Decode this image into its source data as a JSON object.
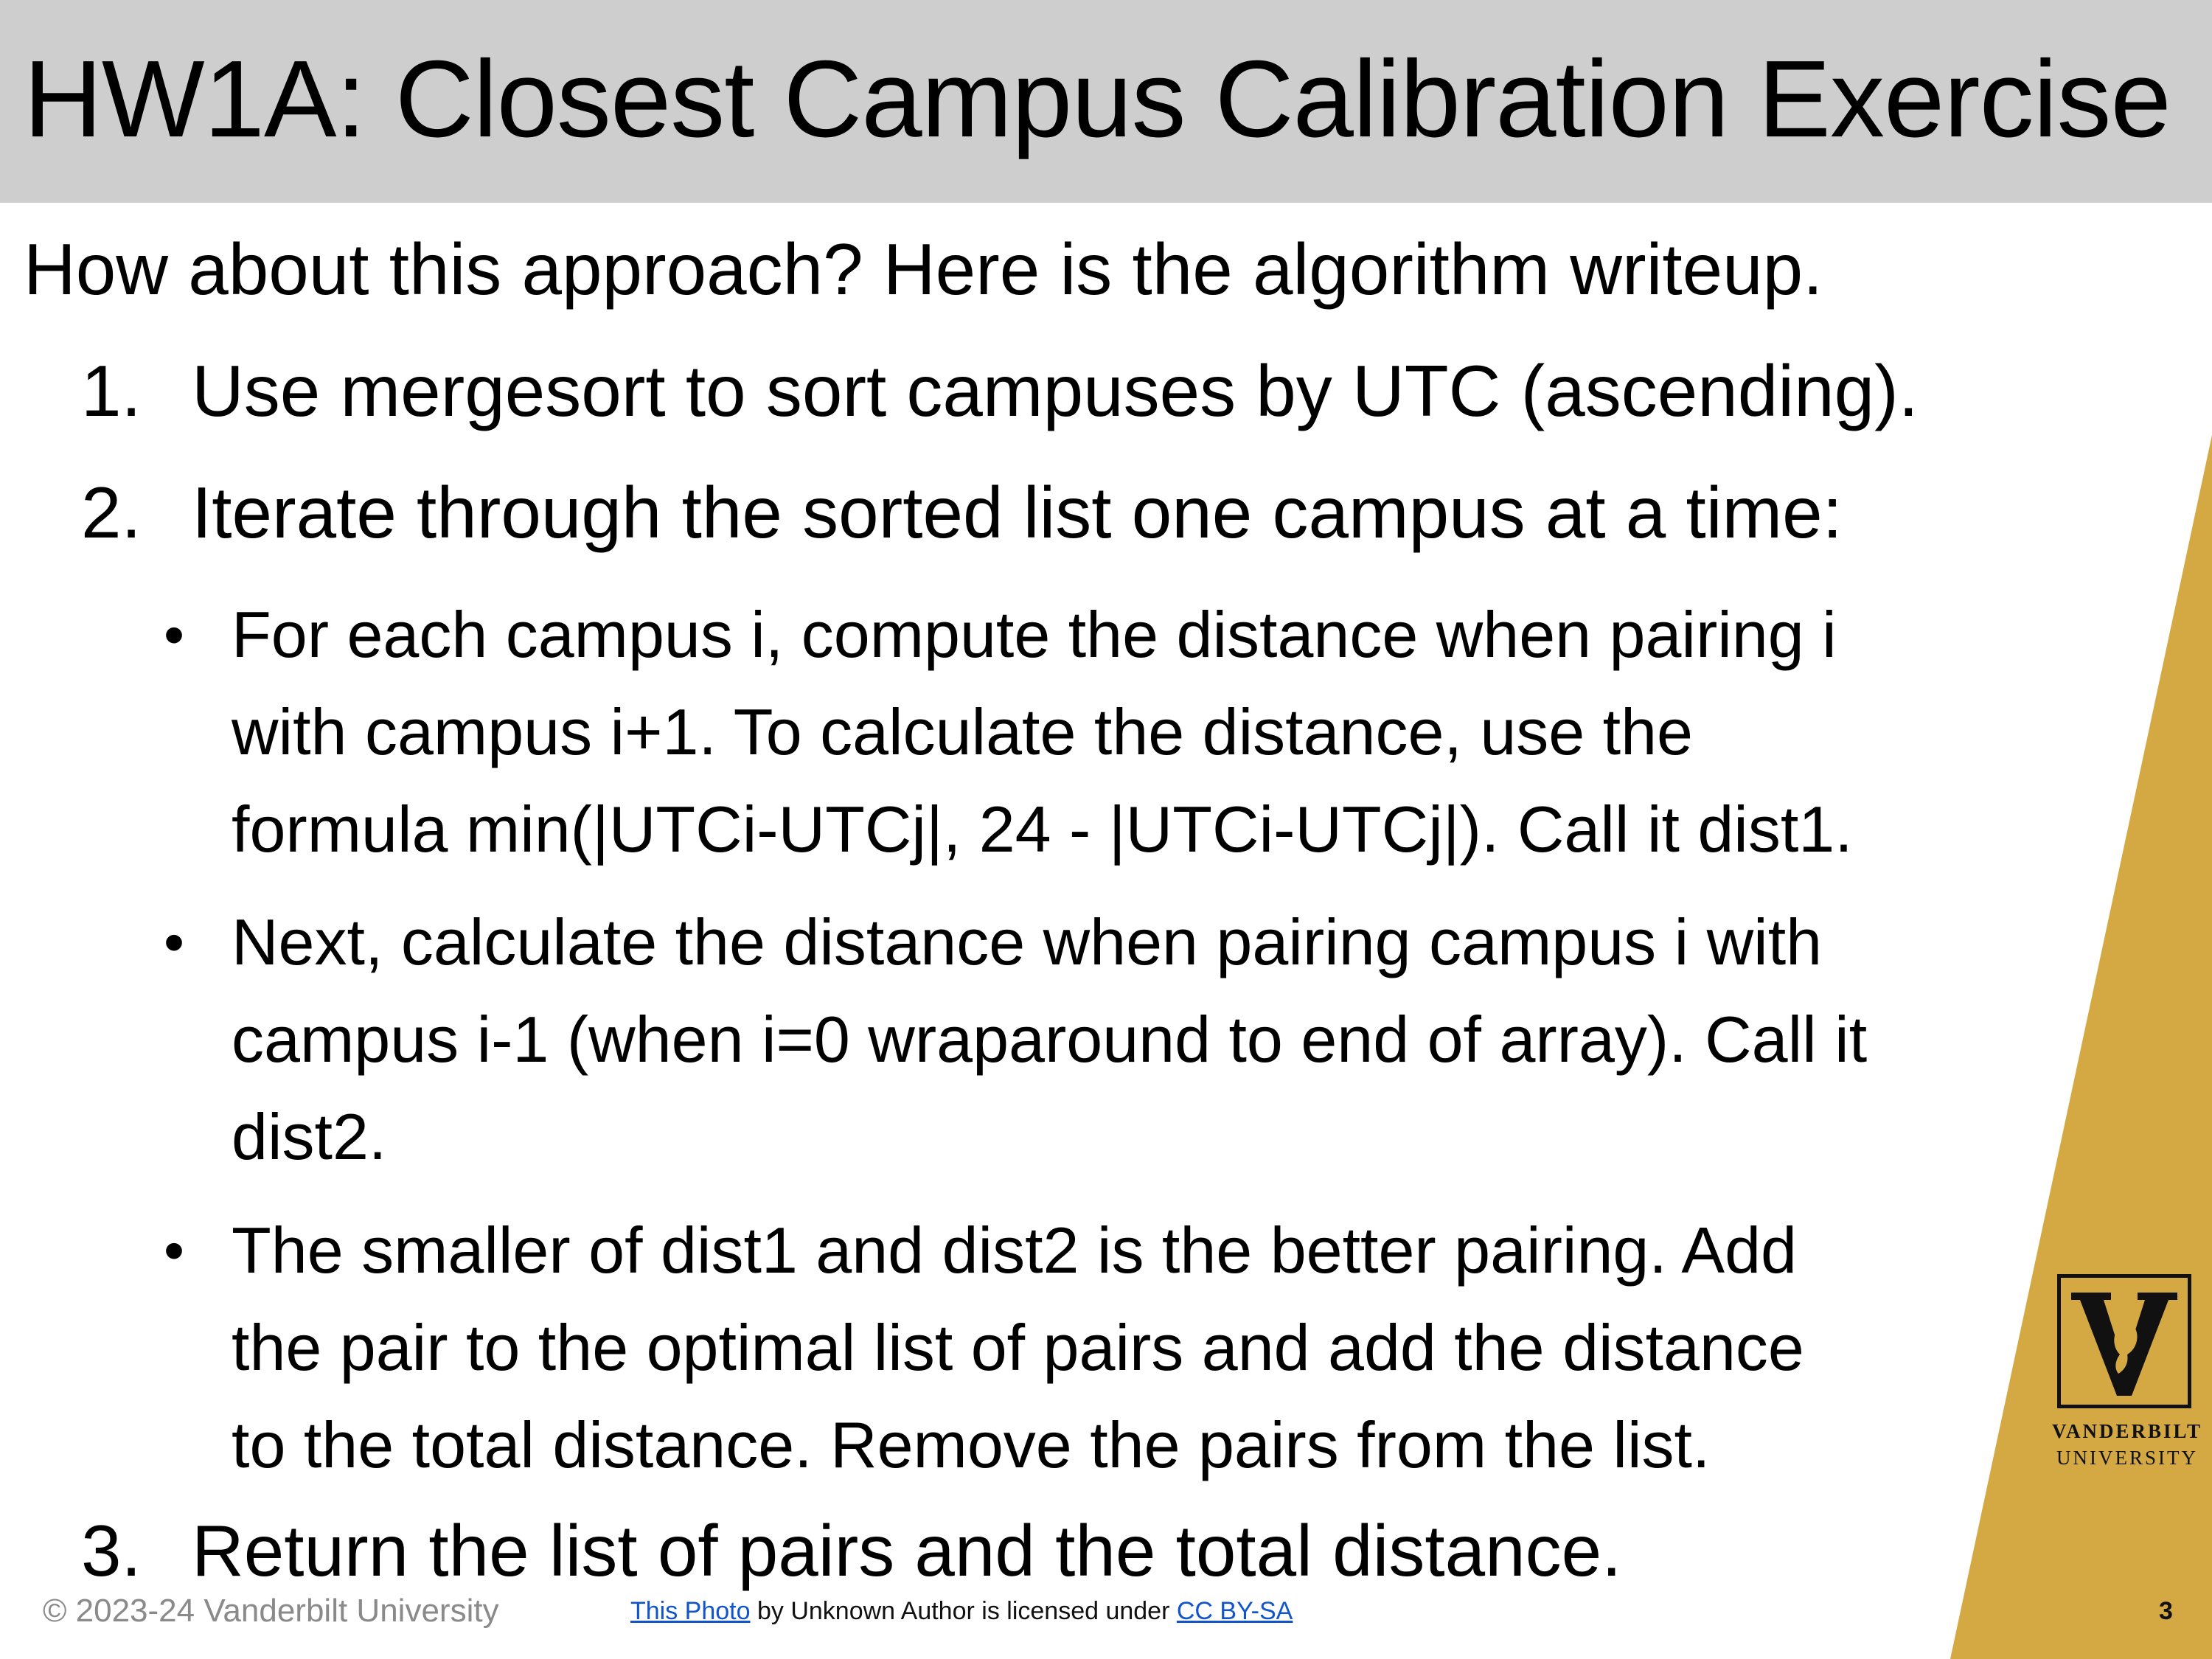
{
  "slide": {
    "title": "HW1A: Closest Campus Calibration Exercise",
    "intro": "How about this approach? Here is the algorithm writeup.",
    "steps": [
      {
        "number": "1.",
        "text": "Use mergesort to sort campuses by UTC (ascending)."
      },
      {
        "number": "2.",
        "text": "Iterate through the sorted list one campus at a time:"
      },
      {
        "number": "3.",
        "text": "Return the list of pairs and the total distance."
      }
    ],
    "bullets": [
      {
        "lines": [
          "For each campus i, compute the distance when pairing i",
          "with campus i+1. To calculate the distance, use the",
          "formula min(|UTCi-UTCj|, 24 - |UTCi-UTCj|). Call it dist1."
        ]
      },
      {
        "lines": [
          "Next, calculate the distance when pairing campus i with",
          "campus i-1 (when i=0 wraparound to end of array). Call it",
          "dist2."
        ]
      },
      {
        "lines": [
          "The smaller of dist1 and dist2 is the better pairing. Add",
          "the pair to the optimal list of pairs and add the distance",
          "to the total distance. Remove the pairs from the list."
        ]
      }
    ],
    "bullet_symbol": "•"
  },
  "footer": {
    "copyright": "© 2023-24 Vanderbilt University",
    "photo_link": "This Photo",
    "credit_middle": " by Unknown Author is licensed under ",
    "license_link": "CC BY-SA",
    "page_number": "3"
  },
  "logo": {
    "line1": "VANDERBILT",
    "line2": "UNIVERSITY",
    "icon": "vanderbilt-v-oak-leaf-logo"
  },
  "colors": {
    "title_bar": "#cfcecf",
    "gold_accent": "#d4a944",
    "link": "#1155cc"
  }
}
